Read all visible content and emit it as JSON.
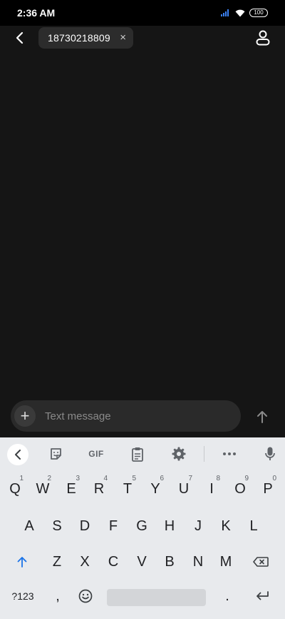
{
  "status_bar": {
    "time": "2:36 AM",
    "battery_level": "100",
    "signal_color": "#3b82f6",
    "icons": [
      "signal-icon",
      "wifi-icon",
      "battery-icon"
    ]
  },
  "header": {
    "back_icon": "back-arrow-icon",
    "recipient_chip": {
      "number": "18730218809",
      "remove_label": "×"
    },
    "contact_icon": "contact-person-icon"
  },
  "composer": {
    "add_label": "+",
    "placeholder": "Text message",
    "value": "",
    "send_icon": "send-arrow-icon"
  },
  "keyboard": {
    "toolbar": {
      "back_icon": "chevron-left-icon",
      "sticker_icon": "sticker-icon",
      "gif_label": "GIF",
      "clipboard_icon": "clipboard-icon",
      "settings_icon": "gear-icon",
      "more_icon": "more-dots-icon",
      "mic_icon": "microphone-icon"
    },
    "row1": [
      {
        "key": "Q",
        "hint": "1"
      },
      {
        "key": "W",
        "hint": "2"
      },
      {
        "key": "E",
        "hint": "3"
      },
      {
        "key": "R",
        "hint": "4"
      },
      {
        "key": "T",
        "hint": "5"
      },
      {
        "key": "Y",
        "hint": "6"
      },
      {
        "key": "U",
        "hint": "7"
      },
      {
        "key": "I",
        "hint": "8"
      },
      {
        "key": "O",
        "hint": "9"
      },
      {
        "key": "P",
        "hint": "0"
      }
    ],
    "row2": [
      "A",
      "S",
      "D",
      "F",
      "G",
      "H",
      "J",
      "K",
      "L"
    ],
    "row3": [
      "Z",
      "X",
      "C",
      "V",
      "B",
      "N",
      "M"
    ],
    "shift_icon": "shift-arrow-icon",
    "backspace_icon": "backspace-icon",
    "bottom": {
      "symbols_label": "?123",
      "comma_label": ",",
      "emoji_icon": "emoji-icon",
      "period_label": ".",
      "enter_icon": "enter-icon"
    },
    "accent_color": "#1a73e8"
  }
}
